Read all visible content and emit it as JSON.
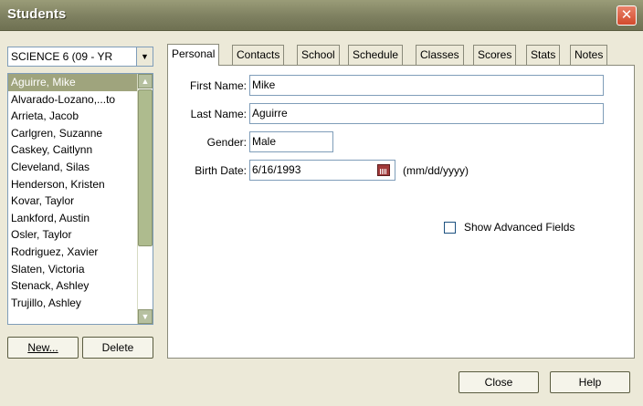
{
  "window": {
    "title": "Students",
    "close_glyph": "✕"
  },
  "class_select": {
    "value": "SCIENCE 6 (09 - YR",
    "arrow": "▼"
  },
  "students": [
    "Aguirre, Mike",
    "Alvarado-Lozano,...to",
    "Arrieta, Jacob",
    "Carlgren, Suzanne",
    "Caskey, Caitlynn",
    "Cleveland, Silas",
    "Henderson, Kristen",
    "Kovar, Taylor",
    "Lankford, Austin",
    "Osler, Taylor",
    "Rodriguez, Xavier",
    "Slaten, Victoria",
    "Stenack, Ashley",
    "Trujillo, Ashley"
  ],
  "selected_student_index": 0,
  "scroll_arrows": {
    "up": "▲",
    "down": "▼"
  },
  "list_buttons": {
    "new": "New...",
    "delete": "Delete"
  },
  "tabs": [
    "Personal",
    "Contacts",
    "School",
    "Schedule",
    "Classes",
    "Scores",
    "Stats",
    "Notes"
  ],
  "active_tab": "Personal",
  "personal": {
    "first_name_label": "First Name:",
    "first_name": "Mike",
    "last_name_label": "Last Name:",
    "last_name": "Aguirre",
    "gender_label": "Gender:",
    "gender": "Male",
    "birth_date_label": "Birth Date:",
    "birth_date": "6/16/1993",
    "birth_date_hint": "(mm/dd/yyyy)",
    "calendar_icon": "calendar-icon",
    "show_advanced_label": "Show Advanced Fields",
    "show_advanced_checked": false
  },
  "footer": {
    "close": "Close",
    "help": "Help"
  },
  "colors": {
    "title_bar": "#7e8060",
    "selection": "#9fa47d",
    "close_button": "#d24a2c"
  }
}
